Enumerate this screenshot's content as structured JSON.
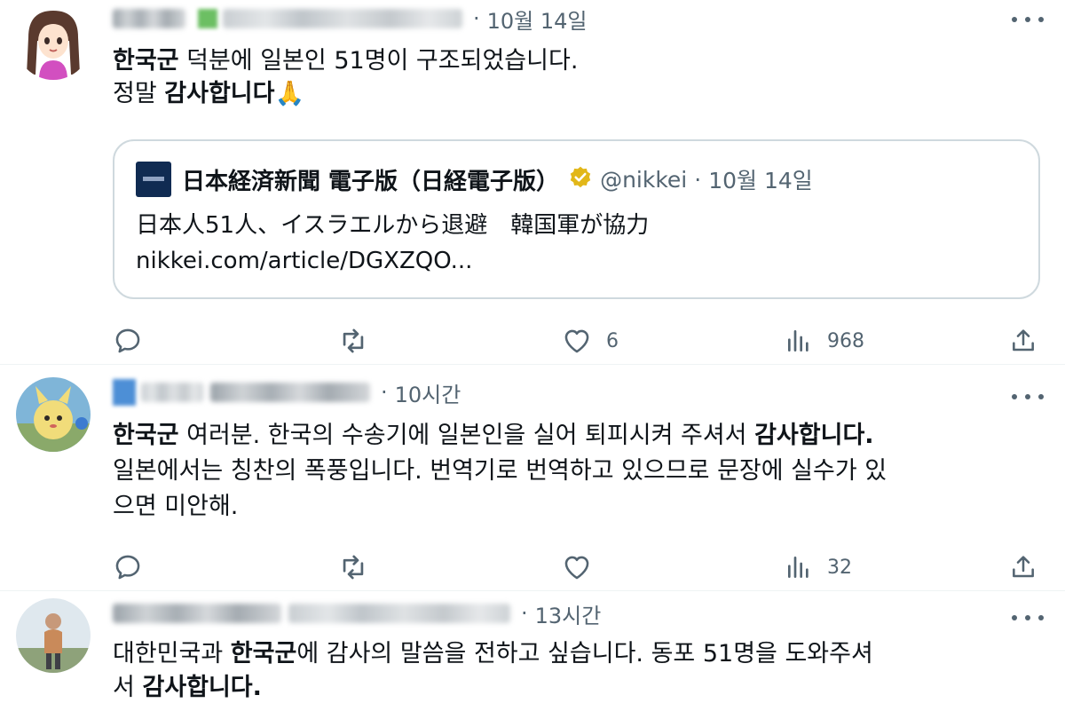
{
  "tweets": [
    {
      "time": "10월 14일",
      "text_lines": [
        {
          "parts": [
            "한국군",
            " 덕분에 일본인 51명이 구조되었습니다."
          ],
          "bold": [
            true,
            false
          ]
        },
        {
          "parts": [
            "정말 ",
            "감사합니다",
            "🙏"
          ],
          "bold": [
            false,
            true,
            false
          ]
        }
      ],
      "quote": {
        "name": "日本経済新聞 電子版（日経電子版）",
        "handle": "@nikkei",
        "time": "10월 14일",
        "headline": "日本人51人、イスラエルから退避　韓国軍が協力",
        "link": "nikkei.com/article/DGXZQO..."
      },
      "actions": {
        "reply": "",
        "retweet": "",
        "like": "6",
        "views": "968"
      }
    },
    {
      "time": "10시간",
      "text_lines": [
        {
          "parts": [
            "한국군",
            " 여러분. 한국의 수송기에 일본인을 실어 퇴피시켜 주셔서 ",
            "감사합니다."
          ],
          "bold": [
            true,
            false,
            true
          ]
        },
        {
          "parts": [
            "일본에서는 칭찬의 폭풍입니다. 번역기로 번역하고 있으므로 문장에 실수가 있"
          ],
          "bold": [
            false
          ]
        },
        {
          "parts": [
            "으면 미안해."
          ],
          "bold": [
            false
          ]
        }
      ],
      "actions": {
        "reply": "",
        "retweet": "",
        "like": "",
        "views": "32"
      }
    },
    {
      "time": "13시간",
      "text_lines": [
        {
          "parts": [
            "대한민국과 ",
            "한국군",
            "에 감사의 말씀을 전하고 싶습니다.  동포 51명을 도와주셔"
          ],
          "bold": [
            false,
            true,
            false
          ]
        },
        {
          "parts": [
            "서 ",
            "감사합니다."
          ],
          "bold": [
            false,
            true
          ]
        }
      ]
    }
  ],
  "colors": {
    "text": "#0f1419",
    "secondary": "#536471",
    "border": "#cfd9de",
    "verified": "#e2b719"
  },
  "icons": [
    "reply-icon",
    "retweet-icon",
    "like-icon",
    "views-icon",
    "share-icon",
    "more-icon",
    "verified-gold-icon"
  ]
}
